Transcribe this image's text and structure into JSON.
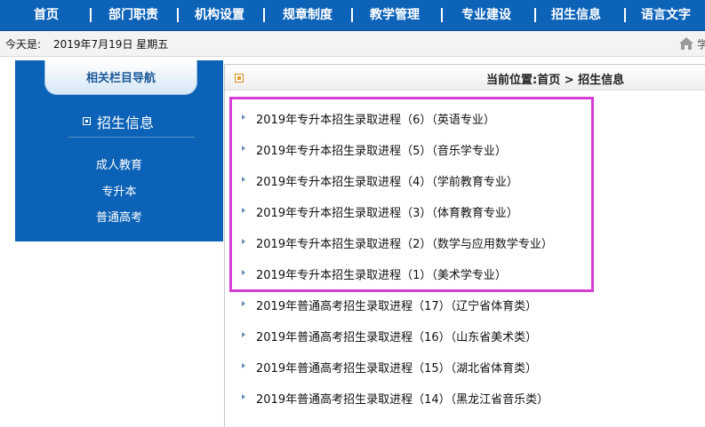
{
  "nav": {
    "items": [
      "首页",
      "部门职责",
      "机构设置",
      "规章制度",
      "教学管理",
      "专业建设",
      "招生信息",
      "语言文字"
    ]
  },
  "datebar": {
    "label": "今天是:",
    "date": "2019年7月19日 星期五",
    "home_text": "学"
  },
  "sidebar": {
    "title": "相关栏目导航",
    "heading": "招生信息",
    "links": [
      "成人教育",
      "专升本",
      "普通高考"
    ]
  },
  "content": {
    "breadcrumb": "当前位置:首页 > 招生信息",
    "items": [
      "2019年专升本招生录取进程（6）（英语专业）",
      "2019年专升本招生录取进程（5）（音乐学专业）",
      "2019年专升本招生录取进程（4）（学前教育专业）",
      "2019年专升本招生录取进程（3）（体育教育专业）",
      "2019年专升本招生录取进程（2）（数学与应用数学专业）",
      "2019年专升本招生录取进程（1）（美术学专业）",
      "2019年普通高考招生录取进程（17）（辽宁省体育类）",
      "2019年普通高考招生录取进程（16）（山东省美术类）",
      "2019年普通高考招生录取进程（15）（湖北省体育类）",
      "2019年普通高考招生录取进程（14）（黑龙江省音乐类）"
    ]
  },
  "colors": {
    "nav_bg": "#0d63b8",
    "sidebar_bg": "#0c62b6",
    "highlight": "#d73ed6"
  }
}
